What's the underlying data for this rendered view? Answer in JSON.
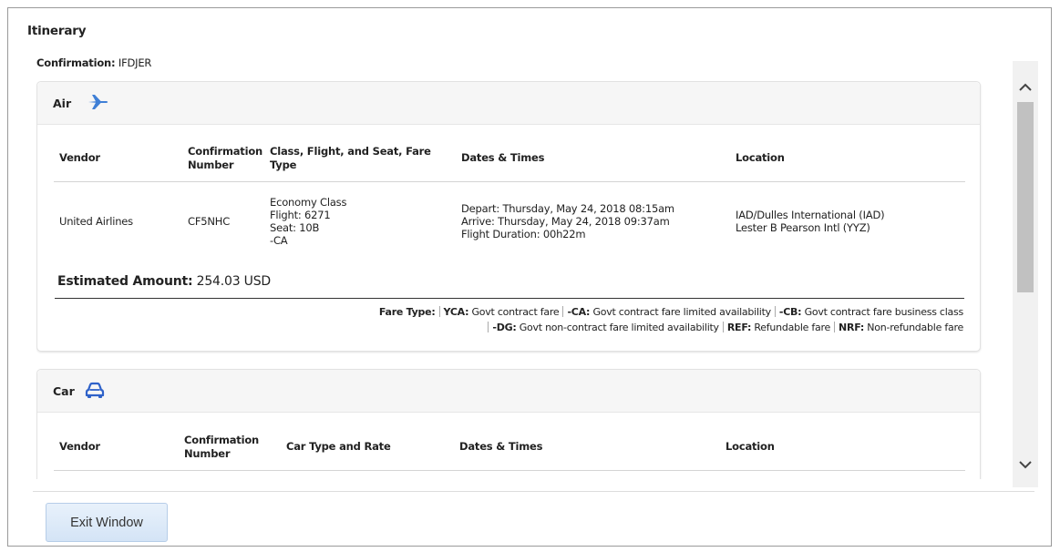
{
  "window": {
    "title": "Itinerary",
    "confirmation_label": "Confirmation:",
    "confirmation_value": "IFDJER"
  },
  "air": {
    "heading": "Air",
    "icon": "airplane-icon",
    "columns": [
      "Vendor",
      "Confirmation Number",
      "Class, Flight, and Seat, Fare Type",
      "Dates & Times",
      "Location"
    ],
    "row": {
      "vendor": "United Airlines",
      "confirmation": "CF5NHC",
      "class_lines": [
        "Economy Class",
        "Flight: 6271",
        "Seat: 10B",
        "-CA"
      ],
      "date_lines": [
        "Depart: Thursday, May 24, 2018 08:15am",
        "Arrive: Thursday, May 24, 2018 09:37am",
        "Flight Duration: 00h22m"
      ],
      "location_lines": [
        "IAD/Dulles International (IAD)",
        "Lester B Pearson Intl (YYZ)"
      ]
    },
    "estimated_label": "Estimated Amount:",
    "estimated_value": "254.03 USD",
    "fare_type": {
      "label": "Fare Type:",
      "codes": [
        {
          "code": "YCA:",
          "desc": "Govt contract fare"
        },
        {
          "code": "-CA:",
          "desc": "Govt contract fare limited availability"
        },
        {
          "code": "-CB:",
          "desc": "Govt contract fare business class"
        },
        {
          "code": "-DG:",
          "desc": "Govt non-contract fare limited availability"
        },
        {
          "code": "REF:",
          "desc": "Refundable fare"
        },
        {
          "code": "NRF:",
          "desc": "Non-refundable fare"
        }
      ]
    }
  },
  "car": {
    "heading": "Car",
    "icon": "car-icon",
    "columns": [
      "Vendor",
      "Confirmation Number",
      "Car Type and Rate",
      "Dates & Times",
      "Location"
    ]
  },
  "footer": {
    "exit_label": "Exit Window"
  },
  "colors": {
    "icon_blue": "#3f7fd6",
    "car_icon": "#2f62c9"
  }
}
